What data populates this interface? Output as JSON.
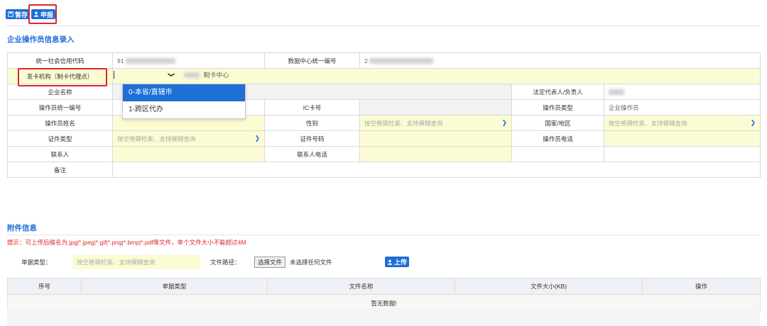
{
  "toolbar": {
    "save_label": "暂存",
    "apply_label": "申报"
  },
  "section_title": "企业操作员信息录入",
  "form": {
    "credit_code_label": "统一社会信用代码",
    "credit_code_value": "91",
    "datacenter_no_label": "数据中心统一编号",
    "datacenter_no_value": "2",
    "card_issuer_label": "发卡机构（制卡代理点）",
    "card_issuer_suffix": "制卡中心",
    "company_name_label": "企业名称",
    "legal_rep_label": "法定代表人/负责人",
    "operator_no_label": "操作员统一编号",
    "ic_card_label": "IC卡号",
    "operator_type_label": "操作员类型",
    "operator_type_value": "企业操作员",
    "operator_name_label": "操作员姓名",
    "gender_label": "性别",
    "gender_placeholder": "按空格键检索、支持模糊查询",
    "country_label": "国家/地区",
    "country_placeholder": "按空格键检索、支持模糊查询",
    "id_type_label": "证件类型",
    "id_type_placeholder": "按空格键检索、支持模糊查询",
    "id_no_label": "证件号码",
    "operator_phone_label": "操作员电话",
    "contact_label": "联系人",
    "contact_phone_label": "联系人电话",
    "remark_label": "备注"
  },
  "dropdown": {
    "options": [
      "0-本省/直辖市",
      "1-跨区代办"
    ],
    "selected_index": 0
  },
  "attachments": {
    "title": "附件信息",
    "tip": "提示：可上传后缀名为.jpg|*.jpeg|*.gif|*.png|*.bmp|*.pdf等文件，单个文件大小不能超过4M",
    "doc_type_label": "单据类型：",
    "doc_type_placeholder": "按空格键检索、支持模糊查询",
    "file_path_label": "文件路径：",
    "choose_file_label": "选择文件",
    "no_file_label": "未选择任何文件",
    "upload_label": "上传",
    "columns": [
      "序号",
      "单据类型",
      "文件名称",
      "文件大小(KB)",
      "操作"
    ],
    "empty_text": "暂无数据!"
  },
  "colors": {
    "accent": "#1e6fd8",
    "highlight": "#e0262a",
    "field_bg": "#fcfcd4"
  }
}
